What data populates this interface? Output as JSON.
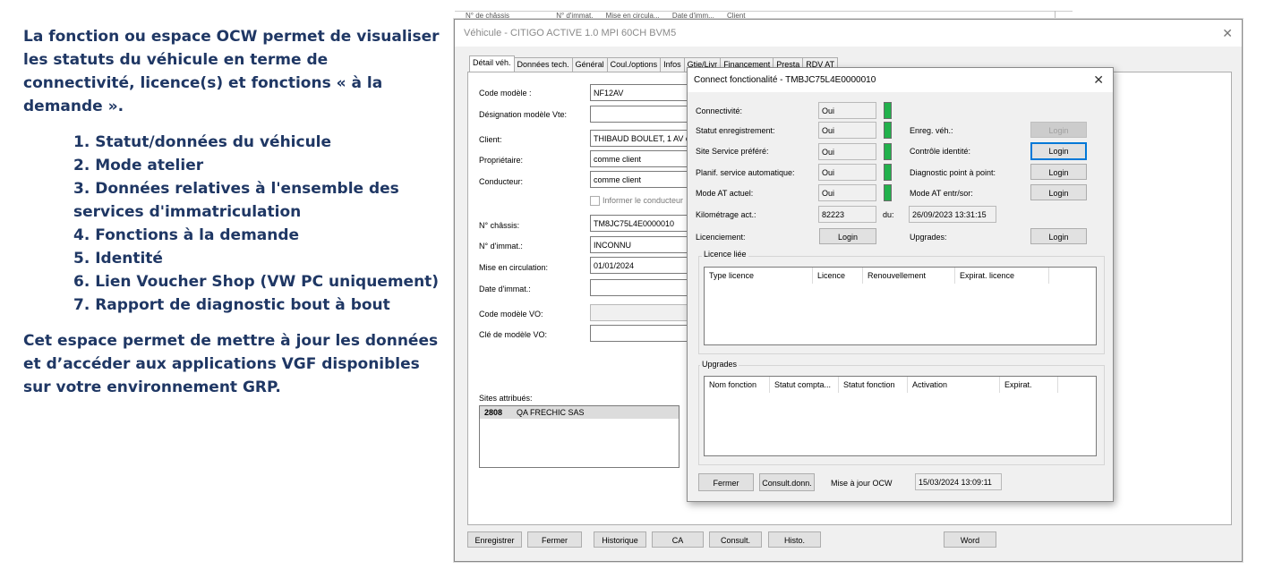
{
  "left_panel": {
    "intro": "La fonction ou espace OCW permet de visualiser les statuts du véhicule en terme de connectivité, licence(s) et fonctions « à la demande ».",
    "items": [
      "1. Statut/données du véhicule",
      "2. Mode atelier",
      "3. Données relatives à l'ensemble des services d'immatriculation",
      "4. Fonctions à la demande",
      "5. Identité",
      "6. Lien Voucher Shop (VW PC uniquement)",
      "7. Rapport de diagnostic bout à bout"
    ],
    "outro": "Cet espace permet de mettre à jour les données et d’accéder aux applications VGF disponibles sur votre environnement GRP."
  },
  "background_window": {
    "columns": [
      "N° de châssis",
      "N° d'immat.",
      "Mise en circula...",
      "Date d'imm...",
      "Client"
    ]
  },
  "vehicle_window": {
    "title": "Véhicule - CITIGO ACTIVE 1.0 MPI 60CH BVM5",
    "close_glyph": "✕",
    "tabs": [
      "Détail véh.",
      "Données tech.",
      "Général",
      "Coul./options",
      "Infos",
      "Gtie/Livr",
      "Financement",
      "Presta",
      "RDV AT"
    ],
    "fields": {
      "code_modele_label": "Code modèle :",
      "code_modele_value": "NF12AV",
      "designation_label": "Désignation modèle Vte:",
      "designation_value": "",
      "client_label": "Client:",
      "client_value": "THIBAUD BOULET, 1 AV d",
      "proprietaire_label": "Propriétaire:",
      "proprietaire_value": "comme client",
      "conducteur_label": "Conducteur:",
      "conducteur_value": "comme client",
      "informer_label": "Informer le conducteur",
      "chassis_label": "N° châssis:",
      "chassis_value": "TM8JC75L4E0000010",
      "immat_label": "N° d'immat.:",
      "immat_value": "INCONNU",
      "mise_label": "Mise en circulation:",
      "mise_value": "01/01/2024",
      "date_immat_label": "Date d'immat.:",
      "date_immat_value": "",
      "code_vo_label": "Code modèle VO:",
      "code_vo_value": "",
      "cle_vo_label": "Clé de modèle VO:",
      "cle_vo_value": ""
    },
    "sites_label": "Sites attribués:",
    "sites": [
      {
        "code": "2808",
        "name": "QA FRECHIC SAS"
      }
    ],
    "buttons": [
      "Enregistrer",
      "Fermer",
      "Historique",
      "CA",
      "Consult.",
      "Histo.",
      "Word"
    ]
  },
  "connect_dialog": {
    "title": "Connect fonctionalité - TMBJC75L4E0000010",
    "close_glyph": "✕",
    "rows": {
      "connectivite_label": "Connectivité:",
      "connectivite_value": "Oui",
      "statut_label": "Statut enregistrement:",
      "statut_value": "Oui",
      "site_label": "Site Service préféré:",
      "site_value": "Oui",
      "planif_label": "Planif. service automatique:",
      "planif_value": "Oui",
      "mode_at_label": "Mode AT actuel:",
      "mode_at_value": "Oui",
      "km_label": "Kilométrage act.:",
      "km_value": "82223",
      "du_label": "du:",
      "du_value": "26/09/2023 13:31:15",
      "licenciement_label": "Licenciement:",
      "enreg_label": "Enreg. véh.:",
      "controle_label": "Contrôle identité:",
      "diag_label": "Diagnostic point à point:",
      "mode_entr_label": "Mode AT entr/sor:",
      "upgrades_label": "Upgrades:",
      "login_label": "Login"
    },
    "indicator_color": "#22b14c",
    "licence_group_label": "Licence liée",
    "licence_columns": [
      "Type licence",
      "Licence",
      "Renouvellement",
      "Expirat. licence"
    ],
    "upgrades_group_label": "Upgrades",
    "upgrades_columns": [
      "Nom fonction",
      "Statut compta...",
      "Statut fonction",
      "Activation",
      "Expirat."
    ],
    "bottom": {
      "fermer": "Fermer",
      "consult": "Consult.donn.",
      "maj_label": "Mise à jour OCW",
      "maj_value": "15/03/2024 13:09:11"
    }
  }
}
